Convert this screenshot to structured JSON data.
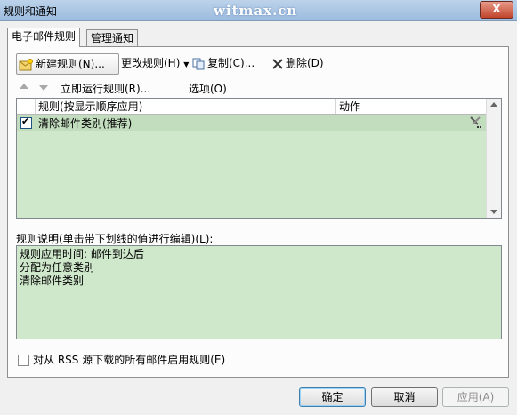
{
  "window": {
    "title": "规则和通知",
    "watermark": "witmax.cn",
    "close_glyph": "X"
  },
  "tabs": [
    {
      "label": "电子邮件规则"
    },
    {
      "label": "管理通知"
    }
  ],
  "toolbar": {
    "new_rule": "新建规则(N)...",
    "change_rule": "更改规则(H)",
    "copy": "复制(C)...",
    "delete": "删除(D)",
    "run_rules": "立即运行规则(R)...",
    "options": "选项(O)"
  },
  "rules_table": {
    "columns": [
      "规则(按显示顺序应用)",
      "动作"
    ],
    "rows": [
      {
        "checked": true,
        "name": "清除邮件类别(推荐)"
      }
    ]
  },
  "description": {
    "label": "规则说明(单击带下划线的值进行编辑)(L):",
    "lines": [
      "规则应用时间: 邮件到达后",
      "分配为任意类别",
      "清除邮件类别"
    ]
  },
  "rss_option": {
    "label": "对从 RSS 源下载的所有邮件启用规则(E)",
    "checked": false
  },
  "buttons": {
    "ok": "确定",
    "cancel": "取消",
    "apply": "应用(A)"
  },
  "colors": {
    "list_background": "#cfe8cb",
    "selected_row": "#c2dcbe"
  }
}
